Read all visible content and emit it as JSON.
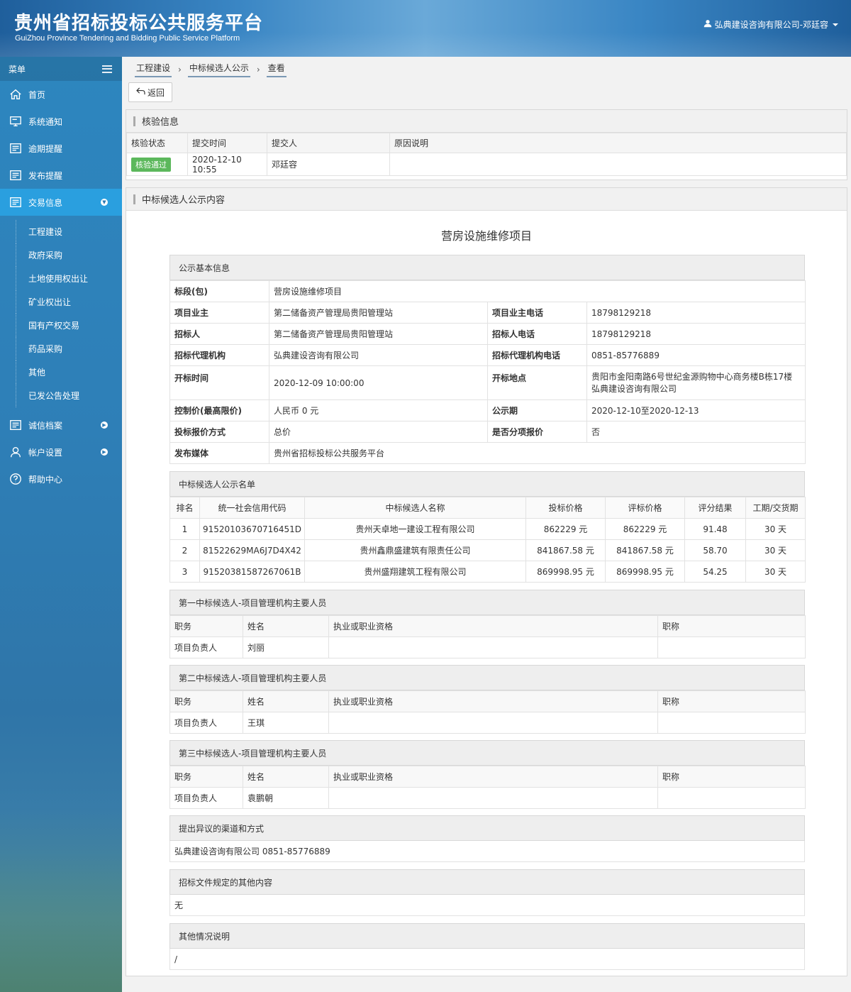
{
  "header": {
    "title": "贵州省招标投标公共服务平台",
    "subtitle": "GuiZhou Province Tendering and Bidding Public Service Platform",
    "user": "弘典建设咨询有限公司-邓廷容"
  },
  "sidebar": {
    "menu_label": "菜单",
    "items": [
      {
        "label": "首页",
        "icon": "home-icon"
      },
      {
        "label": "系统通知",
        "icon": "monitor-icon"
      },
      {
        "label": "逾期提醒",
        "icon": "list-icon"
      },
      {
        "label": "发布提醒",
        "icon": "list-icon"
      },
      {
        "label": "交易信息",
        "icon": "list-icon",
        "active": true
      },
      {
        "label": "诚信档案",
        "icon": "list-icon"
      },
      {
        "label": "帐户设置",
        "icon": "user-icon"
      },
      {
        "label": "帮助中心",
        "icon": "help-icon"
      }
    ],
    "sub_items": [
      "工程建设",
      "政府采购",
      "土地使用权出让",
      "矿业权出让",
      "国有产权交易",
      "药品采购",
      "其他",
      "已发公告处理"
    ]
  },
  "breadcrumb": [
    "工程建设",
    "中标候选人公示",
    "查看"
  ],
  "back_label": "返回",
  "verify": {
    "title": "核验信息",
    "headers": [
      "核验状态",
      "提交时间",
      "提交人",
      "原因说明"
    ],
    "status": "核验通过",
    "time": "2020-12-10 10:55",
    "submitter": "邓廷容",
    "reason": ""
  },
  "content": {
    "panel_title": "中标候选人公示内容",
    "project_title": "营房设施维修项目",
    "basic": {
      "title": "公示基本信息",
      "section_label": "标段(包)",
      "section_value": "营房设施维修项目",
      "owner_label": "项目业主",
      "owner": "第二储备资产管理局贵阳管理站",
      "owner_phone_label": "项目业主电话",
      "owner_phone": "18798129218",
      "tenderer_label": "招标人",
      "tenderer": "第二储备资产管理局贵阳管理站",
      "tenderer_phone_label": "招标人电话",
      "tenderer_phone": "18798129218",
      "agency_label": "招标代理机构",
      "agency": "弘典建设咨询有限公司",
      "agency_phone_label": "招标代理机构电话",
      "agency_phone": "0851-85776889",
      "open_time_label": "开标时间",
      "open_time": "2020-12-09 10:00:00",
      "open_place_label": "开标地点",
      "open_place": "贵阳市金阳南路6号世纪金源购物中心商务楼B栋17楼弘典建设咨询有限公司",
      "control_price_label": "控制价(最高限价)",
      "control_price": "人民币 0 元",
      "period_label": "公示期",
      "period": "2020-12-10至2020-12-13",
      "quote_method_label": "投标报价方式",
      "quote_method": "总价",
      "sub_quote_label": "是否分项报价",
      "sub_quote": "否",
      "media_label": "发布媒体",
      "media": "贵州省招标投标公共服务平台"
    },
    "candidates": {
      "title": "中标候选人公示名单",
      "headers": [
        "排名",
        "统一社会信用代码",
        "中标候选人名称",
        "投标价格",
        "评标价格",
        "评分结果",
        "工期/交货期"
      ],
      "rows": [
        [
          "1",
          "91520103670716451D",
          "贵州天卓地一建设工程有限公司",
          "862229 元",
          "862229 元",
          "91.48",
          "30 天"
        ],
        [
          "2",
          "81522629MA6J7D4X42",
          "贵州鑫鼎盛建筑有限责任公司",
          "841867.58 元",
          "841867.58 元",
          "58.70",
          "30 天"
        ],
        [
          "3",
          "9152038158726706​1B",
          "贵州盛翔建筑工程有限公司",
          "869998.95 元",
          "869998.95 元",
          "54.25",
          "30 天"
        ]
      ]
    },
    "staff_headers": [
      "职务",
      "姓名",
      "执业或职业资格",
      "职称"
    ],
    "staff": [
      {
        "title": "第一中标候选人-项目管理机构主要人员",
        "role": "项目负责人",
        "name": "刘丽",
        "qual": "",
        "rank": ""
      },
      {
        "title": "第二中标候选人-项目管理机构主要人员",
        "role": "项目负责人",
        "name": "王琪",
        "qual": "",
        "rank": ""
      },
      {
        "title": "第三中标候选人-项目管理机构主要人员",
        "role": "项目负责人",
        "name": "袁鹏朝",
        "qual": "",
        "rank": ""
      }
    ],
    "objection": {
      "title": "提出异议的渠道和方式",
      "text": "弘典建设咨询有限公司 0851-85776889"
    },
    "other_content": {
      "title": "招标文件规定的其他内容",
      "text": "无"
    },
    "other_note": {
      "title": "其他情况说明",
      "text": "/"
    }
  }
}
